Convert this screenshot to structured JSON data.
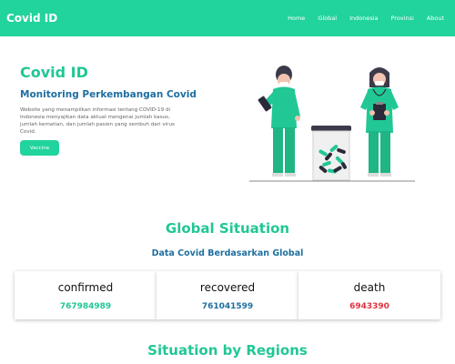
{
  "nav": {
    "brand": "Covid ID",
    "links": [
      "Home",
      "Global",
      "Indonesia",
      "Provinsi",
      "About"
    ]
  },
  "hero": {
    "title": "Covid ID",
    "subtitle": "Monitoring Perkembangan Covid",
    "description": "Website yang menampilkan informasi tentang COVID-19 di Indonesia menyajikan data aktual mengenai jumlah kasus, jumlah kematian, dan jumlah pasien yang sembuh dari virus Covid.",
    "button_label": "Vaccine"
  },
  "global": {
    "title": "Global Situation",
    "subtitle": "Data Covid Berdasarkan Global",
    "stats": [
      {
        "label": "confirmed",
        "value": "767984989",
        "color": "#21c795"
      },
      {
        "label": "recovered",
        "value": "761041599",
        "color": "#1e6fa0"
      },
      {
        "label": "death",
        "value": "6943390",
        "color": "#e03340"
      }
    ]
  },
  "regions": {
    "title": "Situation by Regions"
  },
  "colors": {
    "accent": "#21d39c",
    "heading": "#21c795",
    "subheading": "#1e6fa0",
    "danger": "#e03340"
  }
}
